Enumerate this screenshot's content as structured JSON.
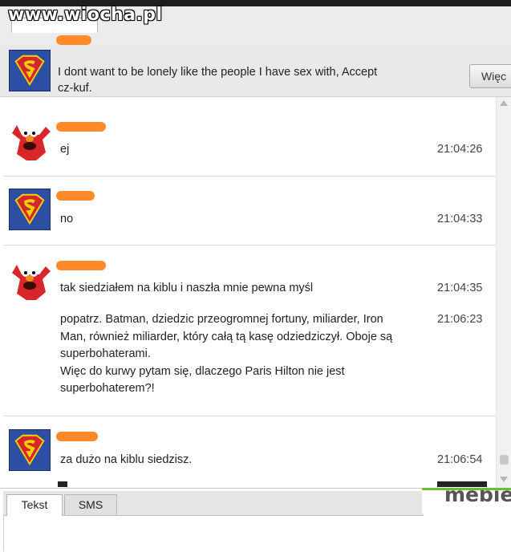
{
  "watermark": "www.wiocha.pl",
  "status": {
    "text_line1": "I dont want to be lonely like the people    I have sex with, Accept",
    "text_line2": "cz-kuf.",
    "more_button": "Więc"
  },
  "messages": [
    {
      "text": "ej",
      "time": "21:04:26",
      "avatar": "elmo-avatar"
    },
    {
      "text": "no",
      "time": "21:04:33",
      "avatar": "superman-avatar"
    },
    {
      "text": "tak siedziałem na kiblu i naszła mnie pewna myśl",
      "time": "21:04:35",
      "avatar": "elmo-avatar"
    },
    {
      "lines": [
        "popatrz. Batman, dziedzic przeogromnej fortuny, miliarder, Iron",
        "Man, również miliarder, który całą tą kasę odziedziczył. Oboje są",
        "superbohaterami.",
        "Więc do kurwy pytam się, dlaczego Paris Hilton nie jest",
        "superbohaterem?!"
      ],
      "time": "21:06:23"
    },
    {
      "text": "za dużo na kiblu siedzisz.",
      "time": "21:06:54",
      "avatar": "superman-avatar"
    }
  ],
  "tabs": {
    "text": "Tekst",
    "sms": "SMS"
  },
  "logo": "mebie",
  "colors": {
    "name_blur": "#ff8a2a",
    "superman_blue": "#2d4fa3",
    "logo_green": "#6bbf2a"
  },
  "icons": [
    "superman-avatar",
    "elmo-avatar",
    "scroll-up-arrow-icon",
    "scroll-down-arrow-icon"
  ]
}
